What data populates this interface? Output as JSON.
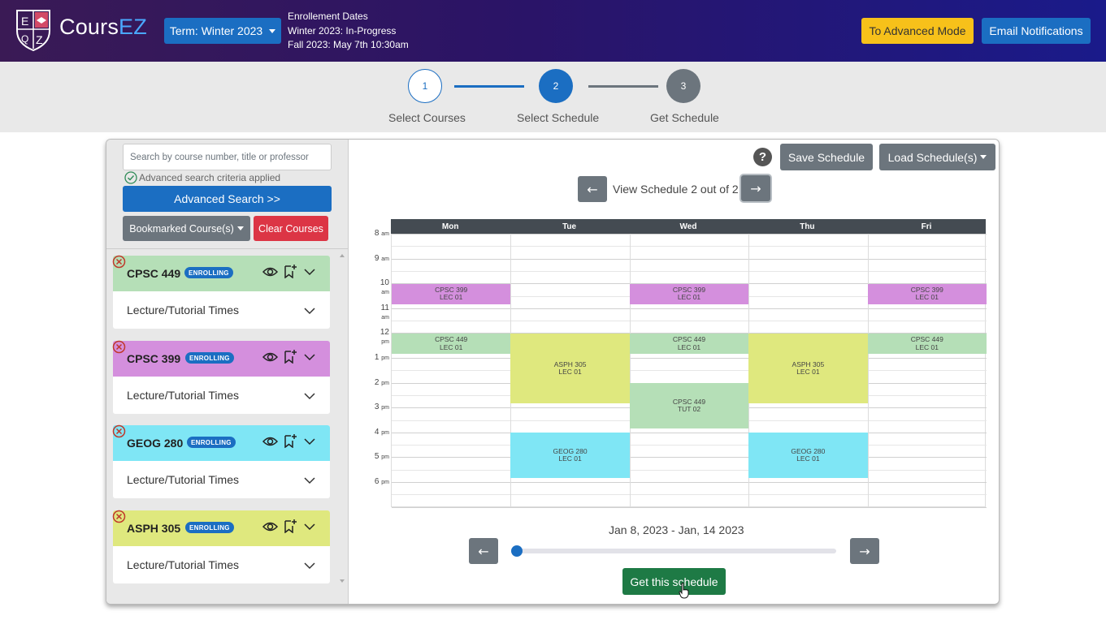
{
  "header": {
    "logo_letters": [
      "E",
      "Q",
      "Z"
    ],
    "brand_prefix": "Cours",
    "brand_suffix": "EZ",
    "term_button": "Term: Winter 2023",
    "enrollment": {
      "title": "Enrollement Dates",
      "line1": "Winter 2023: In-Progress",
      "line2": "Fall 2023: May 7th 10:30am"
    },
    "advanced_mode": "To Advanced Mode",
    "email_notifications": "Email Notifications"
  },
  "stepper": {
    "steps": [
      {
        "number": "1",
        "label": "Select Courses",
        "state": "done"
      },
      {
        "number": "2",
        "label": "Select Schedule",
        "state": "active"
      },
      {
        "number": "3",
        "label": "Get Schedule",
        "state": "pending"
      }
    ],
    "colors": {
      "active": "#1b6ec2",
      "pending": "#6c757d"
    }
  },
  "sidebar": {
    "search_placeholder": "Search by course number, title or professor",
    "criteria_text": "Advanced search criteria applied",
    "advanced_search": "Advanced Search >>",
    "bookmarked": "Bookmarked Course(s)",
    "clear": "Clear Courses",
    "courses": [
      {
        "code": "CPSC 449",
        "badge": "ENROLLING",
        "body": "Lecture/Tutorial Times",
        "color": "#b5dfb7"
      },
      {
        "code": "CPSC 399",
        "badge": "ENROLLING",
        "body": "Lecture/Tutorial Times",
        "color": "#d48fdd"
      },
      {
        "code": "GEOG 280",
        "badge": "ENROLLING",
        "body": "Lecture/Tutorial Times",
        "color": "#7fe6f5"
      },
      {
        "code": "ASPH 305",
        "badge": "ENROLLING",
        "body": "Lecture/Tutorial Times",
        "color": "#dfe87e"
      }
    ]
  },
  "toolbar": {
    "help": "?",
    "save": "Save Schedule",
    "load": "Load Schedule(s)",
    "prev_arrow": "←",
    "next_arrow": "→",
    "view_text": "View Schedule 2 out of 2"
  },
  "calendar": {
    "days": [
      "Mon",
      "Tue",
      "Wed",
      "Thu",
      "Fri"
    ],
    "hours": [
      {
        "num": "8",
        "suffix": "am"
      },
      {
        "num": "9",
        "suffix": "am"
      },
      {
        "num": "10",
        "suffix": "am"
      },
      {
        "num": "11",
        "suffix": "am"
      },
      {
        "num": "12",
        "suffix": "pm"
      },
      {
        "num": "1",
        "suffix": "pm"
      },
      {
        "num": "2",
        "suffix": "pm"
      },
      {
        "num": "3",
        "suffix": "pm"
      },
      {
        "num": "4",
        "suffix": "pm"
      },
      {
        "num": "5",
        "suffix": "pm"
      },
      {
        "num": "6",
        "suffix": "pm"
      }
    ],
    "events": [
      {
        "day": 0,
        "start": 10,
        "end": 10.83,
        "l1": "CPSC 399",
        "l2": "LEC 01",
        "color": "#d48fdd"
      },
      {
        "day": 2,
        "start": 10,
        "end": 10.83,
        "l1": "CPSC 399",
        "l2": "LEC 01",
        "color": "#d48fdd"
      },
      {
        "day": 4,
        "start": 10,
        "end": 10.83,
        "l1": "CPSC 399",
        "l2": "LEC 01",
        "color": "#d48fdd"
      },
      {
        "day": 0,
        "start": 12,
        "end": 12.83,
        "l1": "CPSC 449",
        "l2": "LEC 01",
        "color": "#b5dfb7"
      },
      {
        "day": 2,
        "start": 12,
        "end": 12.83,
        "l1": "CPSC 449",
        "l2": "LEC 01",
        "color": "#b5dfb7"
      },
      {
        "day": 4,
        "start": 12,
        "end": 12.83,
        "l1": "CPSC 449",
        "l2": "LEC 01",
        "color": "#b5dfb7"
      },
      {
        "day": 1,
        "start": 12,
        "end": 14.83,
        "l1": "ASPH 305",
        "l2": "LEC 01",
        "color": "#dfe87e"
      },
      {
        "day": 3,
        "start": 12,
        "end": 14.83,
        "l1": "ASPH 305",
        "l2": "LEC 01",
        "color": "#dfe87e"
      },
      {
        "day": 2,
        "start": 14,
        "end": 15.83,
        "l1": "CPSC 449",
        "l2": "TUT 02",
        "color": "#b5dfb7"
      },
      {
        "day": 1,
        "start": 16,
        "end": 17.83,
        "l1": "GEOG 280",
        "l2": "LEC 01",
        "color": "#7fe6f5"
      },
      {
        "day": 3,
        "start": 16,
        "end": 17.83,
        "l1": "GEOG 280",
        "l2": "LEC 01",
        "color": "#7fe6f5"
      }
    ]
  },
  "footer": {
    "date_range": "Jan 8, 2023 - Jan, 14 2023",
    "slider_value": 0,
    "get_schedule": "Get this schedule"
  }
}
